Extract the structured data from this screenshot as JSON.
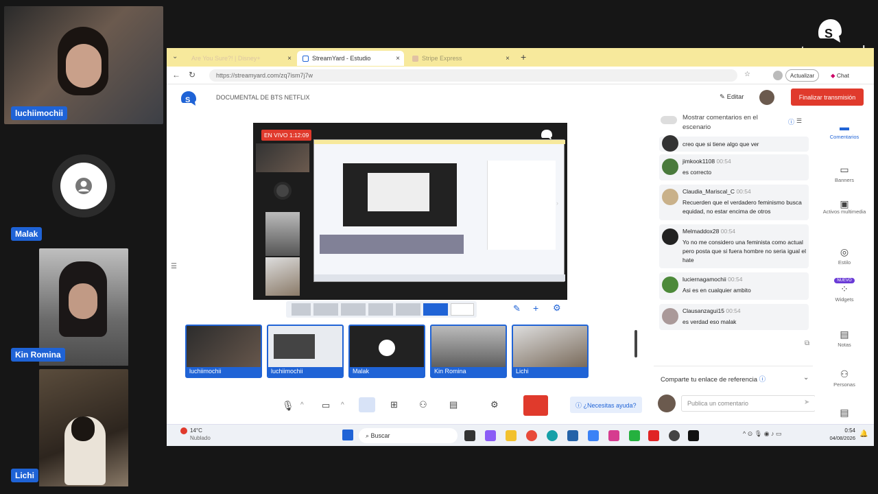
{
  "participants": [
    {
      "name": "luchiimochii"
    },
    {
      "name": "Malak"
    },
    {
      "name": "Kin Romina"
    },
    {
      "name": "Lichi"
    }
  ],
  "brand": {
    "wordmark": "streamyard"
  },
  "browser": {
    "tabs": [
      {
        "label": "Are You Sure?! | Disney+"
      },
      {
        "label": "StreamYard - Estudio"
      },
      {
        "label": "Stripe Express"
      }
    ],
    "new_tab": "+",
    "url": "https://streamyard.com/zq7ism7j7w",
    "update_label": "Actualizar",
    "chat_label": "Chat"
  },
  "studio": {
    "broadcast_title": "DOCUMENTAL DE BTS NETFLIX",
    "edit_label": "Editar",
    "end_label": "Finalizar transmisión",
    "live_badge": "EN VIVO 1:12:09",
    "help_label": "¿Necesitas ayuda?"
  },
  "layout_buttons": [
    "solo",
    "grupo",
    "delgado",
    "dividido",
    "lado",
    "pantalla",
    "pantalla-completa"
  ],
  "stage_participants": [
    {
      "label": "luchiimochii",
      "kind": "camera"
    },
    {
      "label": "luchiimochii",
      "kind": "screen"
    },
    {
      "label": "Malak",
      "kind": "avatar"
    },
    {
      "label": "Kin Romina",
      "kind": "camera"
    },
    {
      "label": "Lichi",
      "kind": "camera"
    }
  ],
  "comments_panel": {
    "toggle_label": "Mostrar comentarios en el escenario",
    "comments": [
      {
        "user": "",
        "time": "",
        "text": "creo que si tiene algo que ver"
      },
      {
        "user": "jimkook1108",
        "time": "00:54",
        "text": "es correcto"
      },
      {
        "user": "Claudia_Mariscal_C",
        "time": "00:54",
        "text": "Recuerden que el verdadero feminismo busca equidad, no estar encima de otros"
      },
      {
        "user": "Melmaddox28",
        "time": "00:54",
        "text": "Yo no me considero una feminista como actual pero posta que si fuera hombre no seria igual el hate"
      },
      {
        "user": "luciernagamochii",
        "time": "00:54",
        "text": "Asi es en cualquier ambito"
      },
      {
        "user": "Clausanzagui15",
        "time": "00:54",
        "text": "es verdad eso malak"
      }
    ],
    "referral_label": "Comparte tu enlace de referencia",
    "input_placeholder": "Publica un comentario"
  },
  "rail": [
    {
      "label": "Comentarios",
      "icon": "chat-icon"
    },
    {
      "label": "Banners",
      "icon": "banner-icon"
    },
    {
      "label": "Activos multimedia",
      "icon": "media-icon"
    },
    {
      "label": "Estilo",
      "icon": "palette-icon"
    },
    {
      "label": "Widgets",
      "icon": "widgets-icon",
      "badge": "NUEVO"
    },
    {
      "label": "Notas",
      "icon": "notes-icon"
    },
    {
      "label": "Personas",
      "icon": "people-icon"
    }
  ],
  "taskbar": {
    "weather_temp": "14°C",
    "weather_desc": "Nublado",
    "search_label": "Buscar",
    "time": "0:54",
    "date": "04/08/2026"
  },
  "colors": {
    "accent_blue": "#1f63d6",
    "end_red": "#e03a2c",
    "tab_yellow": "#f7e99c"
  }
}
